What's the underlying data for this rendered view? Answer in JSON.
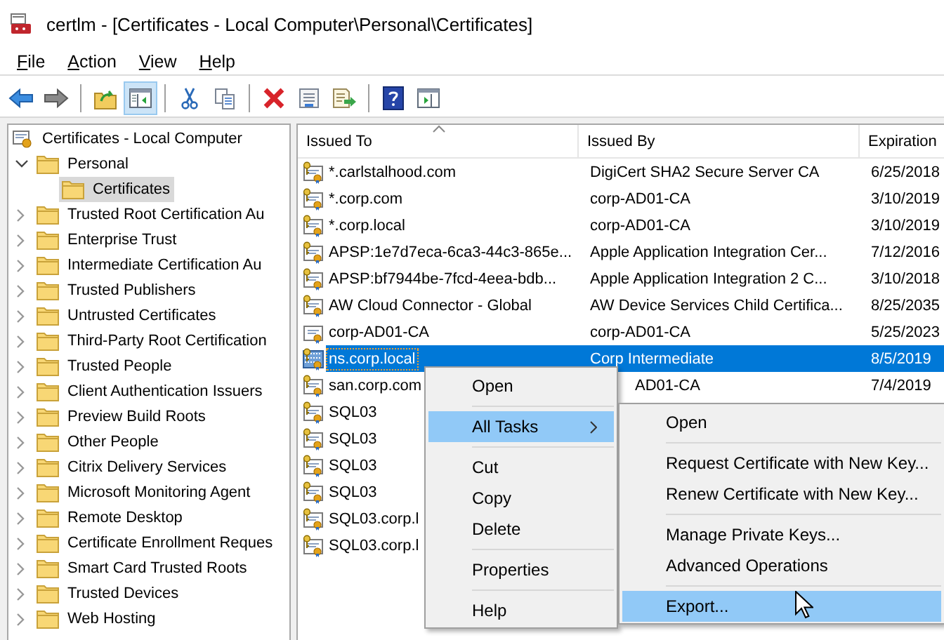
{
  "window": {
    "title": "certlm - [Certificates - Local Computer\\Personal\\Certificates]"
  },
  "menu_bar": [
    {
      "label": "File"
    },
    {
      "label": "Action"
    },
    {
      "label": "View"
    },
    {
      "label": "Help"
    }
  ],
  "toolbar": [
    {
      "kind": "back",
      "pressed": false
    },
    {
      "kind": "forward",
      "pressed": false
    },
    {
      "kind": "separator"
    },
    {
      "kind": "up",
      "pressed": false
    },
    {
      "kind": "tree",
      "pressed": true
    },
    {
      "kind": "separator"
    },
    {
      "kind": "cut",
      "pressed": false
    },
    {
      "kind": "copy",
      "pressed": false
    },
    {
      "kind": "separator"
    },
    {
      "kind": "delete",
      "pressed": false
    },
    {
      "kind": "properties",
      "pressed": false
    },
    {
      "kind": "export",
      "pressed": false
    },
    {
      "kind": "separator"
    },
    {
      "kind": "help",
      "pressed": false
    },
    {
      "kind": "pane",
      "pressed": false
    }
  ],
  "tree": {
    "label": "Certificates - Local Computer",
    "children": [
      {
        "label": "Personal",
        "expanded": true,
        "selected": false,
        "children": [
          {
            "label": "Certificates",
            "selected": true
          }
        ]
      },
      {
        "label": "Trusted Root Certification Au",
        "expanded": false,
        "selected": false
      },
      {
        "label": "Enterprise Trust",
        "expanded": false,
        "selected": false
      },
      {
        "label": "Intermediate Certification Au",
        "expanded": false,
        "selected": false
      },
      {
        "label": "Trusted Publishers",
        "expanded": false,
        "selected": false
      },
      {
        "label": "Untrusted Certificates",
        "expanded": false,
        "selected": false
      },
      {
        "label": "Third-Party Root Certification",
        "expanded": false,
        "selected": false
      },
      {
        "label": "Trusted People",
        "expanded": false,
        "selected": false
      },
      {
        "label": "Client Authentication Issuers",
        "expanded": false,
        "selected": false
      },
      {
        "label": "Preview Build Roots",
        "expanded": false,
        "selected": false
      },
      {
        "label": "Other People",
        "expanded": false,
        "selected": false
      },
      {
        "label": "Citrix Delivery Services",
        "expanded": false,
        "selected": false
      },
      {
        "label": "Microsoft Monitoring Agent",
        "expanded": false,
        "selected": false
      },
      {
        "label": "Remote Desktop",
        "expanded": false,
        "selected": false
      },
      {
        "label": "Certificate Enrollment Reques",
        "expanded": false,
        "selected": false
      },
      {
        "label": "Smart Card Trusted Roots",
        "expanded": false,
        "selected": false
      },
      {
        "label": "Trusted Devices",
        "expanded": false,
        "selected": false
      },
      {
        "label": "Web Hosting",
        "expanded": false,
        "selected": false
      }
    ]
  },
  "table": {
    "columns": [
      {
        "label": "Issued To",
        "sorted": true
      },
      {
        "label": "Issued By",
        "sorted": false
      },
      {
        "label": "Expiration",
        "sorted": false
      }
    ],
    "rows": [
      {
        "cells": [
          "*.carlstalhood.com",
          "DigiCert SHA2 Secure Server CA",
          "6/25/2018"
        ],
        "has_key": true,
        "selected": false
      },
      {
        "cells": [
          "*.corp.com",
          "corp-AD01-CA",
          "3/10/2019"
        ],
        "has_key": true,
        "selected": false
      },
      {
        "cells": [
          "*.corp.local",
          "corp-AD01-CA",
          "3/10/2019"
        ],
        "has_key": true,
        "selected": false
      },
      {
        "cells": [
          "APSP:1e7d7eca-6ca3-44c3-865e...",
          "Apple Application Integration Cer...",
          "7/12/2016"
        ],
        "has_key": true,
        "selected": false
      },
      {
        "cells": [
          "APSP:bf7944be-7fcd-4eea-bdb...",
          "Apple Application Integration 2 C...",
          "3/10/2018"
        ],
        "has_key": true,
        "selected": false
      },
      {
        "cells": [
          "AW Cloud Connector - Global",
          "AW Device Services Child Certifica...",
          "8/25/2035"
        ],
        "has_key": true,
        "selected": false
      },
      {
        "cells": [
          "corp-AD01-CA",
          "corp-AD01-CA",
          "5/25/2023"
        ],
        "has_key": false,
        "selected": false
      },
      {
        "cells": [
          "ns.corp.local",
          "Corp Intermediate",
          "8/5/2019"
        ],
        "has_key": true,
        "selected": true
      },
      {
        "cells": [
          "san.corp.com",
          "AD01-CA",
          "7/4/2019"
        ],
        "has_key": true,
        "selected": false,
        "covered": true
      },
      {
        "cells": [
          "SQL03"
        ],
        "has_key": true,
        "selected": false
      },
      {
        "cells": [
          "SQL03"
        ],
        "has_key": true,
        "selected": false
      },
      {
        "cells": [
          "SQL03"
        ],
        "has_key": true,
        "selected": false
      },
      {
        "cells": [
          "SQL03"
        ],
        "has_key": true,
        "selected": false
      },
      {
        "cells": [
          "SQL03.corp.l"
        ],
        "has_key": true,
        "selected": false
      },
      {
        "cells": [
          "SQL03.corp.l"
        ],
        "has_key": true,
        "selected": false
      }
    ]
  },
  "context_menu": {
    "items": [
      {
        "kind": "item",
        "label": "Open",
        "selected": false
      },
      {
        "kind": "separator"
      },
      {
        "kind": "submenu",
        "label": "All Tasks",
        "selected": true
      },
      {
        "kind": "separator"
      },
      {
        "kind": "item",
        "label": "Cut",
        "selected": false
      },
      {
        "kind": "item",
        "label": "Copy",
        "selected": false
      },
      {
        "kind": "item",
        "label": "Delete",
        "selected": false
      },
      {
        "kind": "separator"
      },
      {
        "kind": "item",
        "label": "Properties",
        "selected": false
      },
      {
        "kind": "separator"
      },
      {
        "kind": "item",
        "label": "Help",
        "selected": false
      }
    ]
  },
  "submenu": {
    "items": [
      {
        "kind": "item",
        "label": "Open",
        "selected": false
      },
      {
        "kind": "separator"
      },
      {
        "kind": "item",
        "label": "Request Certificate with New Key...",
        "selected": false
      },
      {
        "kind": "item",
        "label": "Renew Certificate with New Key...",
        "selected": false
      },
      {
        "kind": "separator"
      },
      {
        "kind": "item",
        "label": "Manage Private Keys...",
        "selected": false
      },
      {
        "kind": "item",
        "label": "Advanced Operations",
        "selected": false
      },
      {
        "kind": "separator"
      },
      {
        "kind": "item",
        "label": "Export...",
        "selected": true
      }
    ]
  }
}
